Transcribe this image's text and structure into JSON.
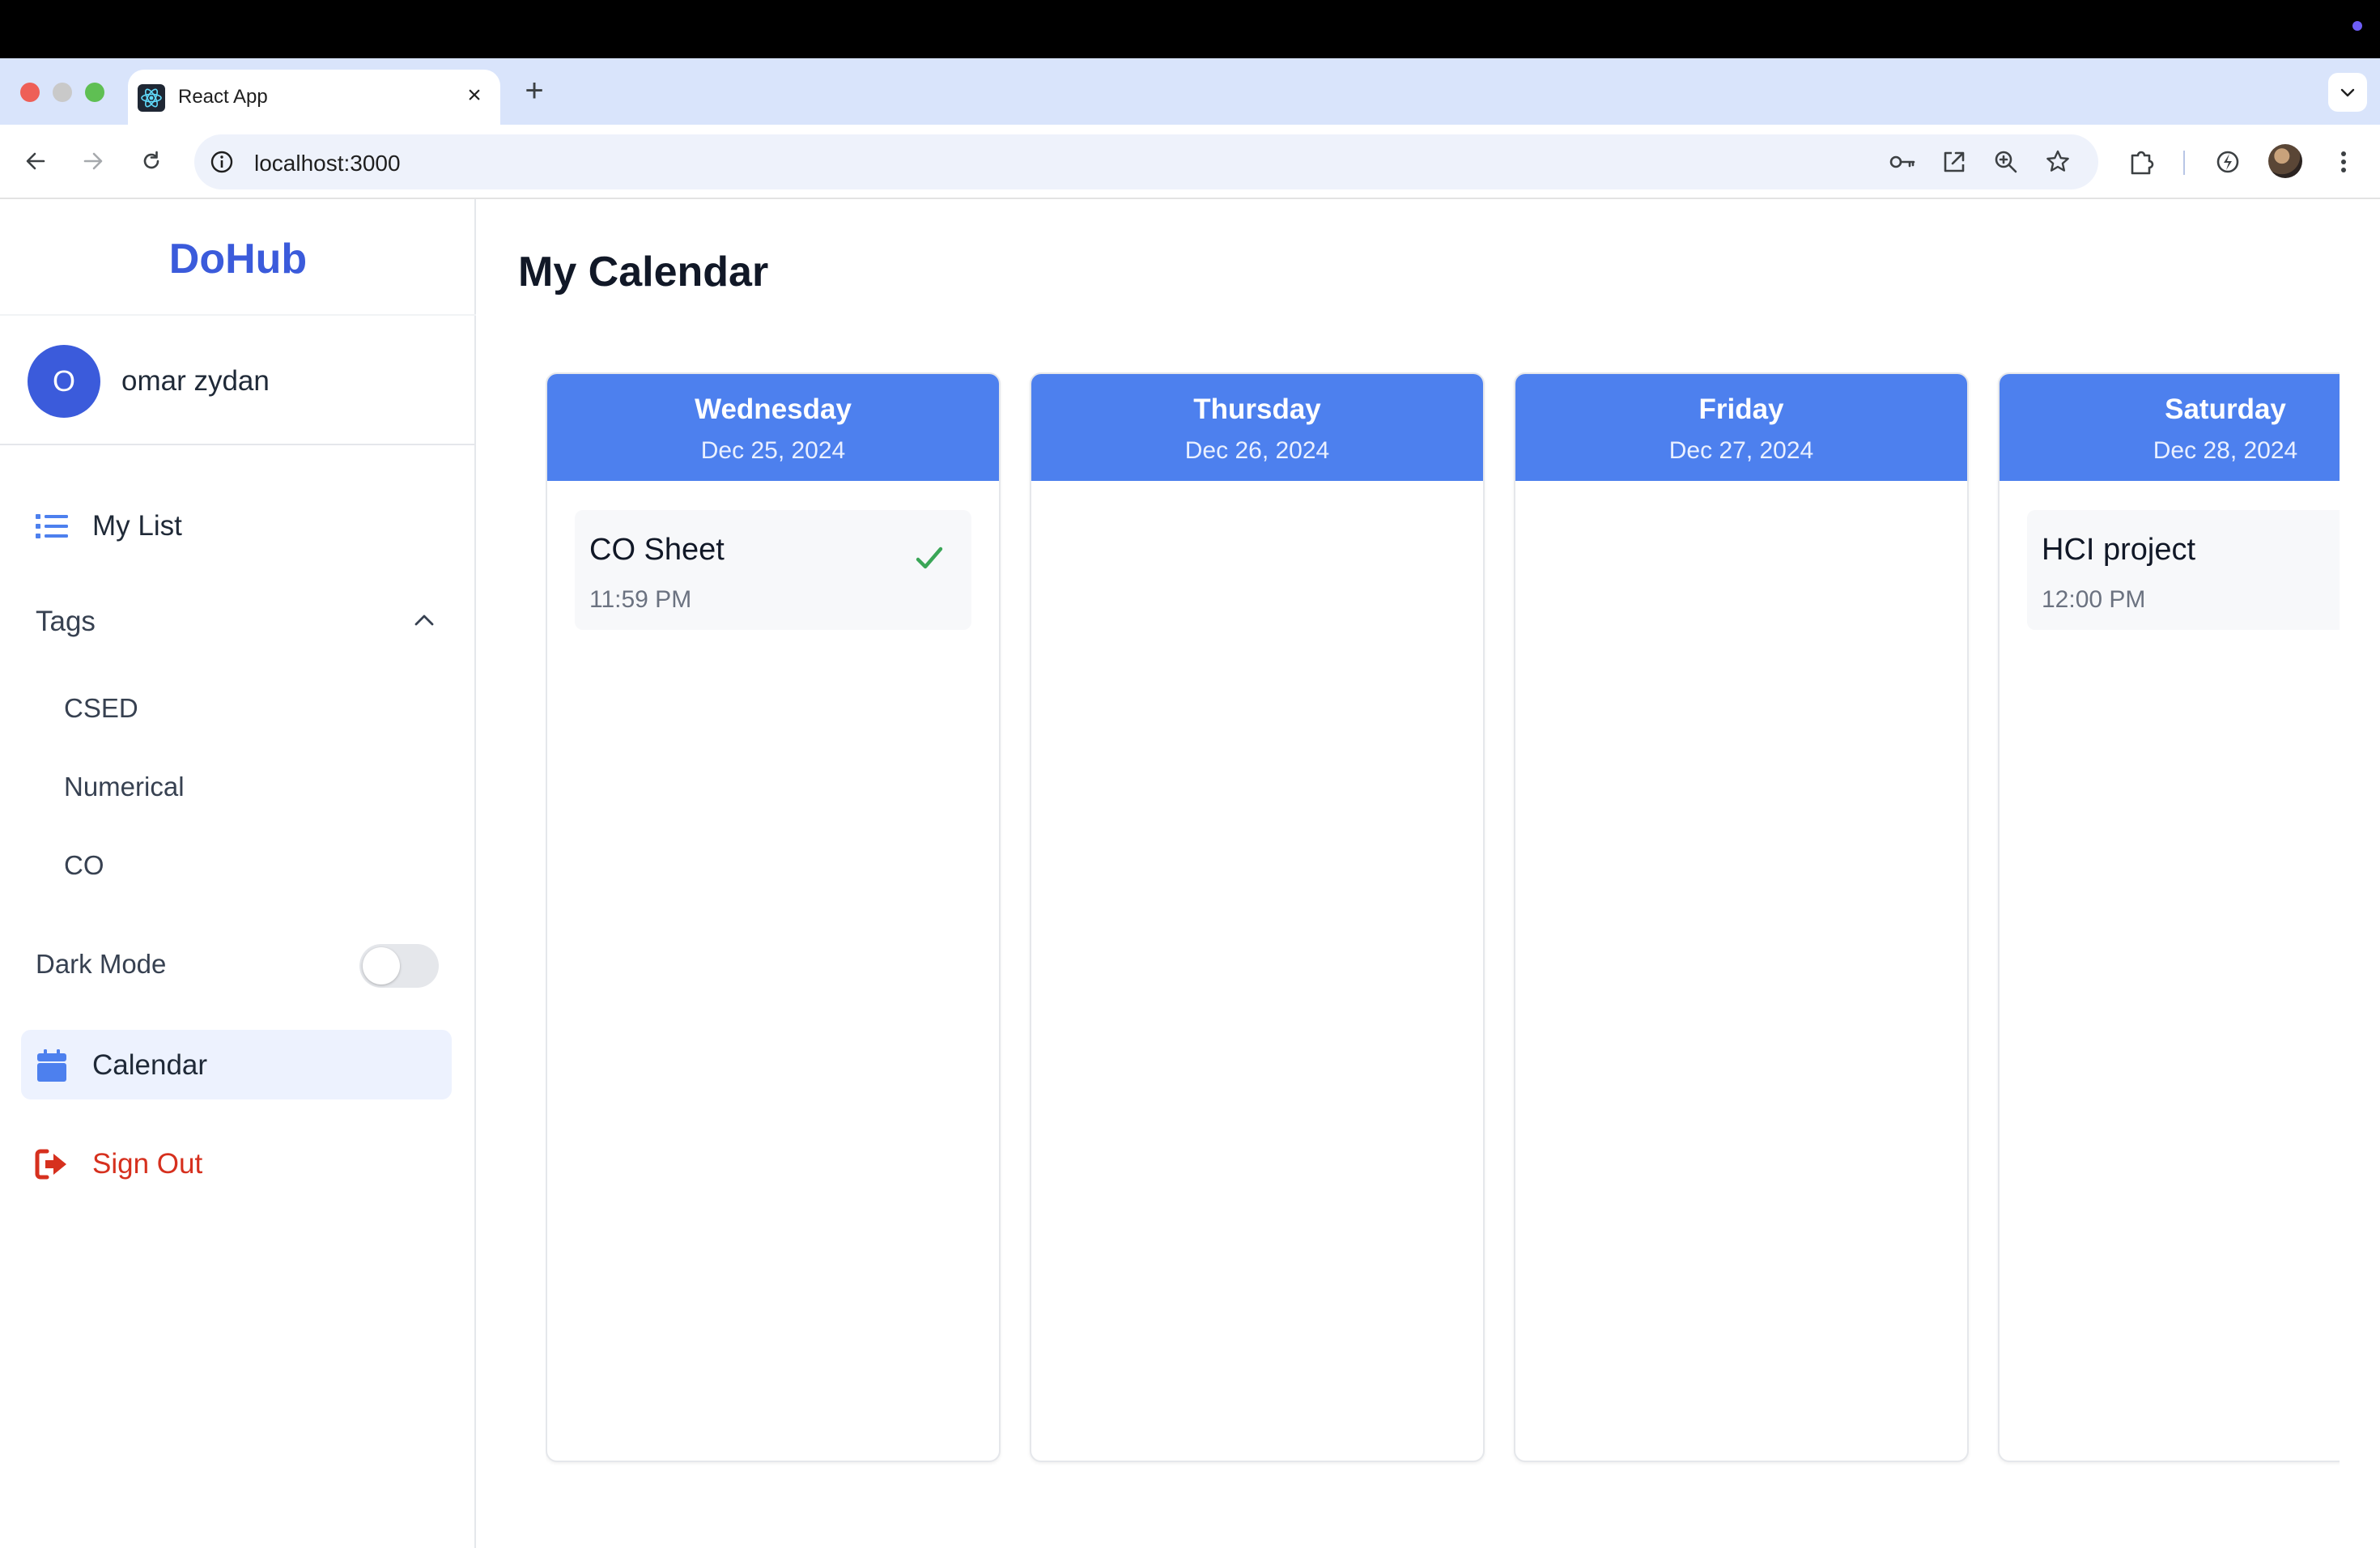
{
  "browser": {
    "tab_title": "React App",
    "tab_close": "×",
    "new_tab": "+",
    "url": "localhost:3000",
    "toolbar_icons": [
      "back-icon",
      "forward-icon",
      "reload-icon",
      "site-info-icon",
      "password-key-icon",
      "open-in-new-icon",
      "zoom-icon",
      "bookmark-star-icon",
      "extensions-icon",
      "performance-icon",
      "profile-avatar",
      "more-menu-icon"
    ]
  },
  "sidebar": {
    "brand": "DoHub",
    "user": {
      "initial": "O",
      "name": "omar zydan"
    },
    "my_list_label": "My List",
    "tags_label": "Tags",
    "tags": [
      "CSED",
      "Numerical",
      "CO"
    ],
    "dark_mode_label": "Dark Mode",
    "dark_mode_on": false,
    "calendar_label": "Calendar",
    "sign_out_label": "Sign Out"
  },
  "main": {
    "title": "My Calendar",
    "days": [
      {
        "name": "Wednesday",
        "date": "Dec 25, 2024",
        "tasks": [
          {
            "title": "CO Sheet",
            "time": "11:59 PM",
            "completed": true
          }
        ]
      },
      {
        "name": "Thursday",
        "date": "Dec 26, 2024",
        "tasks": []
      },
      {
        "name": "Friday",
        "date": "Dec 27, 2024",
        "tasks": []
      },
      {
        "name": "Saturday",
        "date": "Dec 28, 2024",
        "tasks": [
          {
            "title": "HCI project",
            "time": "12:00 PM",
            "completed": false
          }
        ]
      }
    ]
  },
  "colors": {
    "brand": "#3b5bdb",
    "day_header": "#4d80ee",
    "active_nav_bg": "#edf2fe",
    "sign_out": "#d6301e",
    "check": "#3aa657"
  }
}
